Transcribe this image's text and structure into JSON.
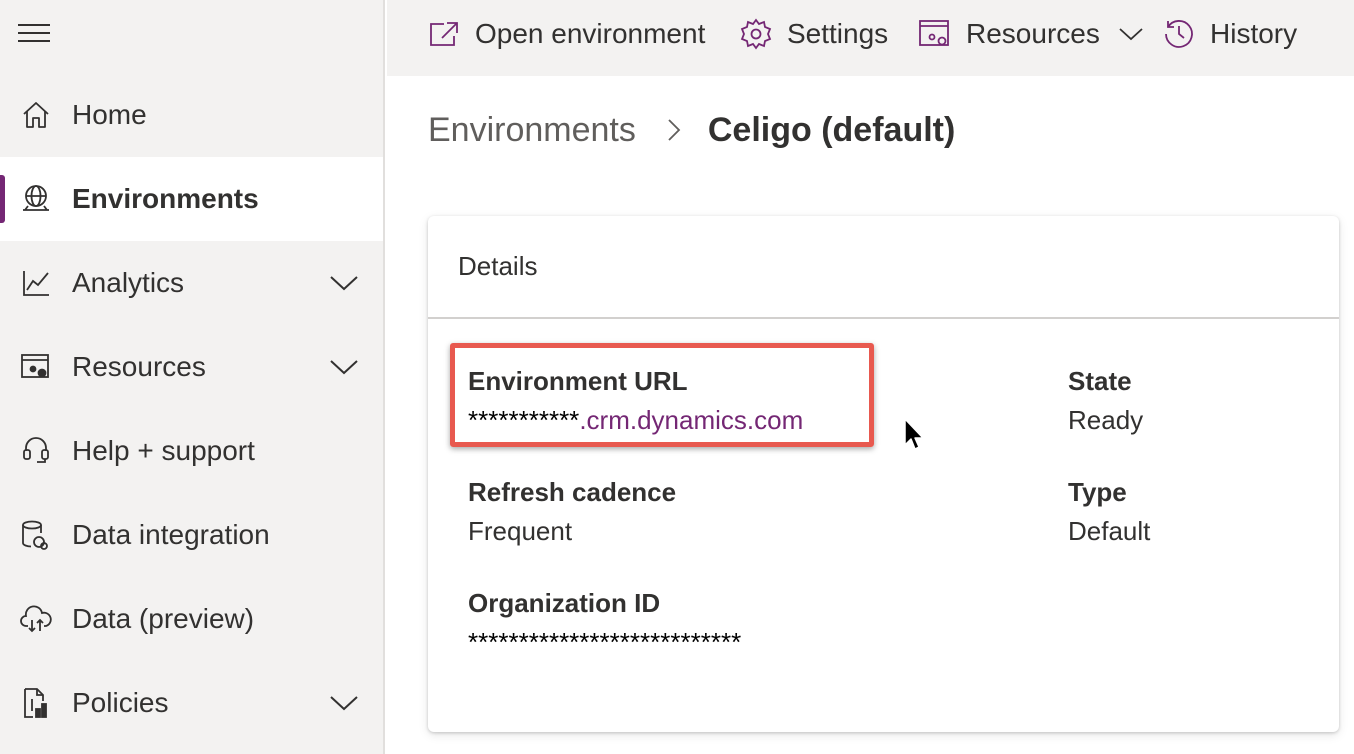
{
  "command_bar": {
    "open_environment": "Open environment",
    "settings": "Settings",
    "resources": "Resources",
    "history": "History"
  },
  "sidebar": {
    "items": [
      {
        "label": "Home",
        "icon": "home-icon"
      },
      {
        "label": "Environments",
        "icon": "globe-icon",
        "active": true
      },
      {
        "label": "Analytics",
        "icon": "chart-line-icon",
        "expandable": true
      },
      {
        "label": "Resources",
        "icon": "resources-icon",
        "expandable": true
      },
      {
        "label": "Help + support",
        "icon": "headset-icon"
      },
      {
        "label": "Data integration",
        "icon": "data-integration-icon"
      },
      {
        "label": "Data (preview)",
        "icon": "cloud-data-icon"
      },
      {
        "label": "Policies",
        "icon": "policies-icon",
        "expandable": true
      }
    ]
  },
  "breadcrumb": {
    "parent": "Environments",
    "current": "Celigo (default)"
  },
  "details": {
    "title": "Details",
    "environment_url": {
      "label": "Environment URL",
      "masked": "***********",
      "domain": ".crm.dynamics.com"
    },
    "state": {
      "label": "State",
      "value": "Ready"
    },
    "refresh_cadence": {
      "label": "Refresh cadence",
      "value": "Frequent"
    },
    "type": {
      "label": "Type",
      "value": "Default"
    },
    "organization_id": {
      "label": "Organization ID",
      "value": "***************************"
    }
  },
  "colors": {
    "accent": "#742774",
    "highlight": "#e8594f",
    "sidebar_bg": "#f3f2f1"
  }
}
